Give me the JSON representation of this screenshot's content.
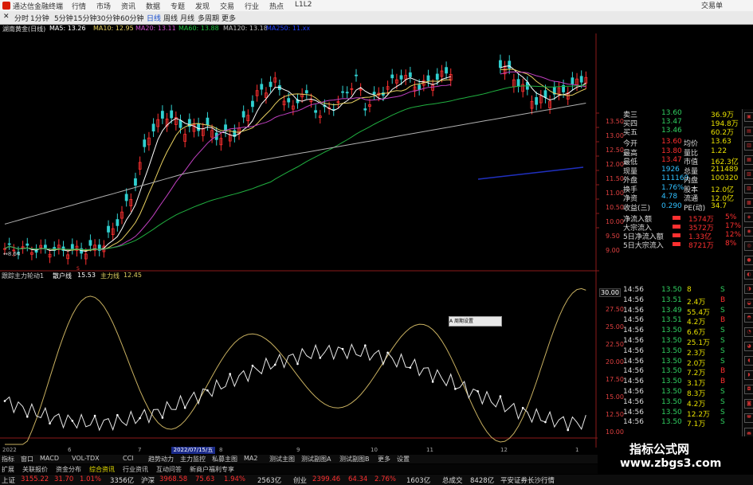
{
  "window": {
    "title": "通达信金融终端",
    "right_label": "交易单"
  },
  "menu": {
    "items": [
      "分时",
      "1分钟",
      "5分钟",
      "15分钟",
      "30分钟",
      "60分钟",
      "日线",
      "周线",
      "月线",
      "多周期",
      "更多"
    ],
    "top_items": [
      "行情",
      "市场",
      "资讯",
      "数据",
      "专题",
      "发现",
      "交易",
      "行业",
      "热点",
      "L1L2"
    ]
  },
  "stock_header": {
    "name": "湖南黄金(日线)",
    "ma5": "MA5: 13.26",
    "ma10": "MA10: 12.95",
    "ma20": "MA20: 13.11",
    "ma60": "MA60: 13.88",
    "ma120": "MA120: 13.18",
    "ma250": "MA250: 11.xx"
  },
  "main_chart": {
    "price_axis": [
      "13.50",
      "13.00",
      "12.50",
      "12.00",
      "11.50",
      "11.00",
      "10.50",
      "10.00",
      "9.50",
      "9.00"
    ],
    "low_label": "8.64",
    "low_marker": "S"
  },
  "indicator": {
    "name": "跟踪主力轮动1",
    "line1_label": "散户线",
    "line1_value": "15.53",
    "line2_label": "主力线",
    "line2_value": "12.45",
    "axis": [
      "30.00",
      "27.50",
      "25.00",
      "22.50",
      "20.00",
      "17.50",
      "15.00",
      "12.50",
      "10.00"
    ],
    "popup": "A 周期设置"
  },
  "x_axis": {
    "labels": [
      "2022",
      "6",
      "7",
      "8",
      "9",
      "10",
      "11",
      "12",
      "1"
    ],
    "selected_date": "2022/07/15/五"
  },
  "quote_panel": {
    "top": [
      {
        "label": "卖三",
        "value": "13.60",
        "vol": "36.9万"
      },
      {
        "label": "买四",
        "value": "13.47",
        "vol": "194.8万"
      },
      {
        "label": "买五",
        "value": "13.46",
        "vol": "60.2万"
      }
    ],
    "stats": [
      {
        "l1": "今开",
        "v1": "13.60",
        "l2": "均价",
        "v2": "13.63"
      },
      {
        "l1": "最高",
        "v1": "13.80",
        "l2": "量比",
        "v2": "1.22"
      },
      {
        "l1": "最低",
        "v1": "13.47",
        "l2": "市值",
        "v2": "162.3亿"
      },
      {
        "l1": "现量",
        "v1": "1926",
        "l2": "总量",
        "v2": "211489"
      },
      {
        "l1": "外盘",
        "v1": "111169",
        "l2": "内盘",
        "v2": "100320"
      },
      {
        "l1": "换手",
        "v1": "1.76%",
        "l2": "股本",
        "v2": "12.0亿"
      },
      {
        "l1": "净资",
        "v1": "4.78",
        "l2": "流通",
        "v2": "12.0亿"
      },
      {
        "l1": "收益(三)",
        "v1": "0.290",
        "l2": "PE(动)",
        "v2": "34.7"
      }
    ],
    "flows": [
      {
        "label": "净流入额",
        "value": "1574万",
        "pct": "5%"
      },
      {
        "label": "大宗流入",
        "value": "3572万",
        "pct": "17%"
      },
      {
        "label": "5日净流入额",
        "value": "1.33亿",
        "pct": "12%"
      },
      {
        "label": "5日大宗流入",
        "value": "8721万",
        "pct": "8%"
      }
    ],
    "ticks": [
      {
        "t": "14:56",
        "p": "13.50",
        "v": "8",
        "bs": "S"
      },
      {
        "t": "14:56",
        "p": "13.51",
        "v": "2.4万",
        "bs": "B"
      },
      {
        "t": "14:56",
        "p": "13.49",
        "v": "55.4万",
        "bs": "S"
      },
      {
        "t": "14:56",
        "p": "13.51",
        "v": "4.2万",
        "bs": "B"
      },
      {
        "t": "14:56",
        "p": "13.50",
        "v": "6.6万",
        "bs": "S"
      },
      {
        "t": "14:56",
        "p": "13.50",
        "v": "25.1万",
        "bs": "S"
      },
      {
        "t": "14:56",
        "p": "13.50",
        "v": "2.3万",
        "bs": "S"
      },
      {
        "t": "14:56",
        "p": "13.50",
        "v": "2.0万",
        "bs": "S"
      },
      {
        "t": "14:56",
        "p": "13.50",
        "v": "7.2万",
        "bs": "B"
      },
      {
        "t": "14:56",
        "p": "13.50",
        "v": "3.1万",
        "bs": "B"
      },
      {
        "t": "14:56",
        "p": "13.50",
        "v": "8.3万",
        "bs": "S"
      },
      {
        "t": "14:56",
        "p": "13.50",
        "v": "4.2万",
        "bs": "S"
      },
      {
        "t": "14:56",
        "p": "13.50",
        "v": "12.2万",
        "bs": "S"
      },
      {
        "t": "14:56",
        "p": "13.50",
        "v": "7.1万",
        "bs": "S"
      }
    ]
  },
  "bottom_tabs": [
    "指标",
    "窗口",
    "MACD",
    "VOL-TDX",
    "CCI",
    "趋势动力",
    "主力监控",
    "私募主图",
    "MA2",
    "测试主图",
    "测试副图A",
    "测试副图B",
    "更多",
    "设置"
  ],
  "sub_tabs": [
    "扩展",
    "关联报价",
    "资金分布",
    "综合资讯",
    "行业资讯",
    "互动问答",
    "新商户福利专享"
  ],
  "status": {
    "sh_label": "上证",
    "sh_val": "3155.22",
    "sh_chg": "31.70",
    "sh_pct": "1.01%",
    "sh_amt": "3356亿",
    "sz_label": "沪深",
    "sz_val": "3968.58",
    "sz_chg": "75.63",
    "sz_pct": "1.94%",
    "sz_amt": "2563亿",
    "cy_label": "创业",
    "cy_val": "2399.46",
    "cy_chg": "64.34",
    "cy_pct": "2.76%",
    "cy_amt": "1603亿",
    "total_label": "总成交",
    "total_amt": "8428亿",
    "broker": "平安证券长沙行情"
  },
  "watermark": {
    "line1": "指标公式网",
    "line2": "www.zbgs3.com"
  },
  "colors": {
    "up": "#ff3030",
    "down": "#30d0d0",
    "yellow": "#e0e000",
    "ma_white": "#ffffff",
    "ma_yellow": "#e8d060",
    "ma_purple": "#c040c0",
    "ma_green": "#20b040",
    "ma_gray": "#c0c0c0",
    "indicator_gold": "#c8b060"
  }
}
